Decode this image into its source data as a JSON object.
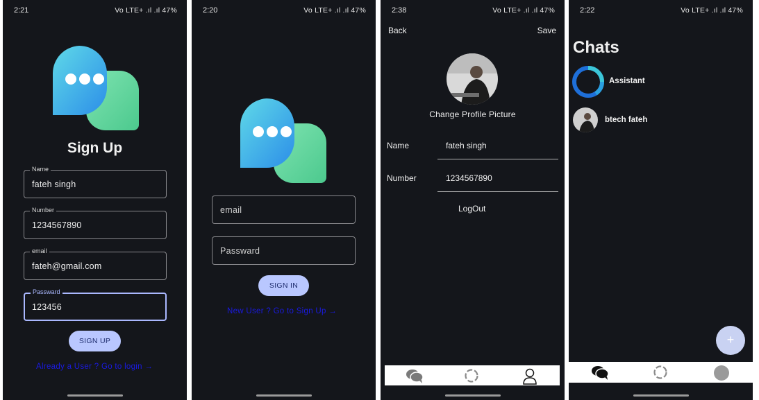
{
  "screens": {
    "signup": {
      "time": "2:21",
      "status": "Vo LTE+ .ıl .ıl 47%",
      "title": "Sign Up",
      "fields": [
        {
          "label": "Name",
          "value": "fateh singh"
        },
        {
          "label": "Number",
          "value": "1234567890"
        },
        {
          "label": "email",
          "value": "fateh@gmail.com"
        },
        {
          "label": "Passward",
          "value": "123456"
        }
      ],
      "button": "SIGN UP",
      "link": "Already a User ? Go to login  →"
    },
    "signin": {
      "time": "2:20",
      "status": "Vo LTE+ .ıl .ıl 47%",
      "email_placeholder": "email",
      "password_placeholder": "Passward",
      "button": "SIGN IN",
      "link": "New User ? Go to Sign Up  →"
    },
    "profile": {
      "time": "2:38",
      "status": "Vo LTE+ .ıl .ıl 47%",
      "back": "Back",
      "save": "Save",
      "change_picture": "Change Profile Picture",
      "name_label": "Name",
      "name_value": "fateh singh",
      "number_label": "Number",
      "number_value": "1234567890",
      "logout": "LogOut"
    },
    "chats": {
      "time": "2:22",
      "status": "Vo LTE+ .ıl .ıl 47%",
      "title": "Chats",
      "items": [
        {
          "name": "Assistant"
        },
        {
          "name": "btech fateh"
        }
      ],
      "fab": "+"
    }
  },
  "colors": {
    "background": "#14161b",
    "accent": "#b9c7ff",
    "link": "#1a1ae0",
    "bubble_blue": "#3aa8f0",
    "bubble_green": "#5fd39c"
  }
}
